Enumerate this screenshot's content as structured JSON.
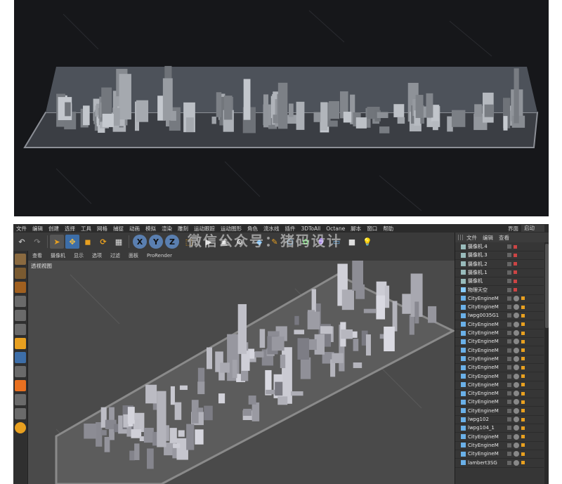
{
  "render_preview": {
    "description_hidden": ""
  },
  "menu": {
    "items": [
      "文件",
      "编辑",
      "创建",
      "选择",
      "工具",
      "网格",
      "捕捉",
      "动画",
      "模拟",
      "渲染",
      "雕刻",
      "运动跟踪",
      "运动图形",
      "角色",
      "流水线",
      "插件",
      "3DToAll",
      "Octane",
      "脚本",
      "窗口",
      "帮助"
    ],
    "layout_label": "界面",
    "layout_value": "启动"
  },
  "toolbar": {
    "axis_x": "X",
    "axis_y": "Y",
    "axis_z": "Z",
    "colors": {
      "move": "#3d6ea8",
      "axis_bg": "#5a7fb0",
      "accent": "#e8a020"
    }
  },
  "viewport": {
    "menu": [
      "查看",
      "摄像机",
      "显示",
      "选项",
      "过滤",
      "面板",
      "ProRender"
    ],
    "title": "透视视图"
  },
  "watermark": "微信公众号：猪码设计",
  "object_manager": {
    "menu": [
      "文件",
      "编辑",
      "查看"
    ],
    "objects": [
      {
        "name": "摄像机.4",
        "type": "camera"
      },
      {
        "name": "摄像机.3",
        "type": "camera"
      },
      {
        "name": "摄像机.2",
        "type": "camera"
      },
      {
        "name": "摄像机.1",
        "type": "camera"
      },
      {
        "name": "摄像机",
        "type": "camera"
      },
      {
        "name": "物理天空",
        "type": "sky"
      },
      {
        "name": "CityEngineM",
        "type": "mesh"
      },
      {
        "name": "CityEngineM",
        "type": "mesh"
      },
      {
        "name": "lwpg0035G1",
        "type": "mesh"
      },
      {
        "name": "CityEngineM",
        "type": "mesh"
      },
      {
        "name": "CityEngineM",
        "type": "mesh"
      },
      {
        "name": "CityEngineM",
        "type": "mesh"
      },
      {
        "name": "CityEngineM",
        "type": "mesh"
      },
      {
        "name": "CityEngineM",
        "type": "mesh"
      },
      {
        "name": "CityEngineM",
        "type": "mesh"
      },
      {
        "name": "CityEngineM",
        "type": "mesh"
      },
      {
        "name": "CityEngineM",
        "type": "mesh"
      },
      {
        "name": "CityEngineM",
        "type": "mesh"
      },
      {
        "name": "CityEngineM",
        "type": "mesh"
      },
      {
        "name": "CityEngineM",
        "type": "mesh"
      },
      {
        "name": "lwpg102",
        "type": "mesh"
      },
      {
        "name": "lwpg104_1",
        "type": "mesh"
      },
      {
        "name": "CityEngineM",
        "type": "mesh"
      },
      {
        "name": "CityEngineM",
        "type": "mesh"
      },
      {
        "name": "CityEngineM",
        "type": "mesh"
      },
      {
        "name": "lambert3SG",
        "type": "mesh"
      }
    ]
  }
}
